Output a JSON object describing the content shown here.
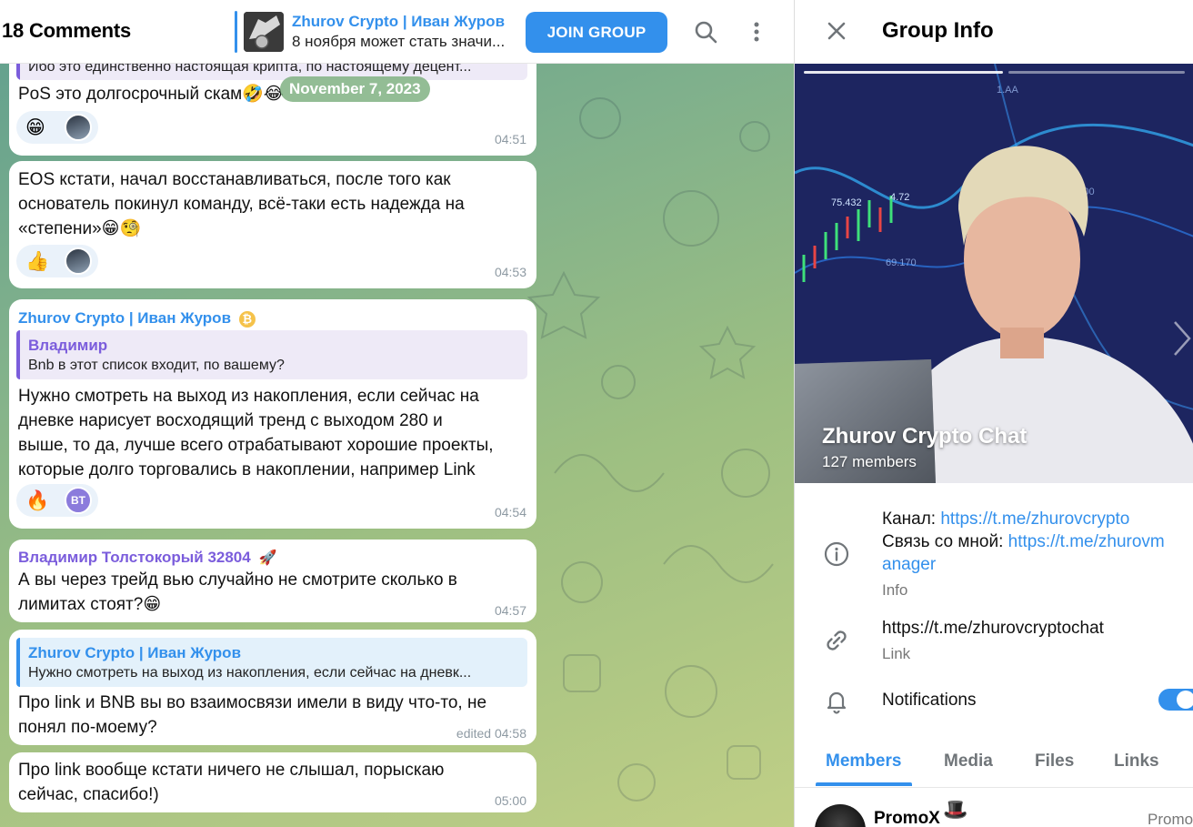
{
  "topbar": {
    "comments_title": "18 Comments",
    "pinned_name": "Zhurov Crypto | Иван Журов",
    "pinned_text": "8 ноября может стать значи...",
    "join_label": "JOIN GROUP"
  },
  "date_pill": "November 7, 2023",
  "messages": [
    {
      "reply_text": "Ибо это единственно настоящая крипта, по настоящему децент...",
      "text": "PoS это долгосрочный скам",
      "emoji": "🤣😂",
      "reaction": "😁",
      "time": "04:51"
    },
    {
      "line1": "EOS кстати, начал восстанавливаться, после того как",
      "line2": "основатель покинул команду, всё-таки есть надежда на",
      "line3": "«степени»",
      "emoji": "😁🧐",
      "reaction": "👍",
      "time": "04:53"
    },
    {
      "sender": "Zhurov Crypto | Иван Журов",
      "sender_badge": "₿",
      "reply_name": "Владимир",
      "reply_text": "Bnb в этот список входит, по вашему?",
      "line1": "Нужно смотреть на выход из накопления, если сейчас на",
      "line2": "дневке нарисует восходящий тренд с выходом 280 и",
      "line3": "выше, то да, лучше всего отрабатывают хорошие проекты,",
      "line4": "которые долго торговались в накоплении, например Link",
      "reaction": "🔥",
      "reaction_avatar": "BT",
      "time": "04:54"
    },
    {
      "sender": "Владимир Толстокорый 32804",
      "sender_badge": "🚀",
      "line1": "А вы через трейд вью случайно не смотрите сколько в",
      "line2": "лимитах стоят?",
      "emoji": "😁",
      "time": "04:57"
    },
    {
      "reply_name": "Zhurov Crypto | Иван Журов",
      "reply_text": "Нужно смотреть на выход из накопления, если сейчас на дневк...",
      "line1": "Про link и BNB вы во взаимосвязи имели в виду что-то, не",
      "line2": "понял по-моему?",
      "time": "edited 04:58"
    },
    {
      "line1": "Про link вообще кстати ничего не слышал, порыскаю",
      "line2": "сейчас, спасибо!)",
      "time": "05:00"
    }
  ],
  "panel": {
    "title": "Group Info",
    "group_name": "Zhurov Crypto Chat",
    "members_count": "127 members",
    "info_line1_prefix": "Канал: ",
    "info_line1_link": "https://t.me/zhurovcrypto",
    "info_line2_prefix": "Связь со мной: ",
    "info_line2_link_a": "https://t.me/zhurovm",
    "info_line2_link_b": "anager",
    "info_label": "Info",
    "link_value": "https://t.me/zhurovcryptochat",
    "link_label": "Link",
    "notifications_label": "Notifications",
    "notifications_on": true,
    "chart_readouts": [
      "75.432",
      "4.72",
      "1.AA",
      "69.170",
      "00.100"
    ],
    "tabs": [
      "Members",
      "Media",
      "Files",
      "Links"
    ],
    "active_tab": "Members",
    "member_name": "PromoX",
    "member_emoji": "🎩",
    "member_role": "Promo"
  },
  "colors": {
    "accent": "#3390ec",
    "reply_purple": "#7b5ddc",
    "sender_blue": "#3390ec",
    "date_pill": "#80b282"
  },
  "icons": {
    "search": "search-icon",
    "more": "more-vertical-icon",
    "close": "close-icon",
    "info": "info-icon",
    "link": "link-icon",
    "bell": "bell-icon",
    "chevron": "chevron-right-icon"
  }
}
